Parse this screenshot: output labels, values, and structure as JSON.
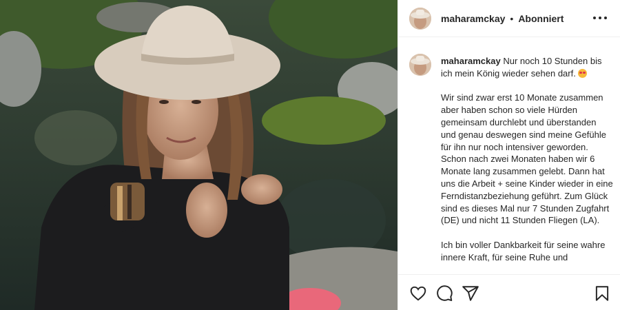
{
  "post": {
    "username": "maharamckay",
    "separator": "•",
    "follow_status": "Abonniert",
    "caption_lead": "Nur noch 10 Stunden bis ich mein König wieder sehen darf.",
    "caption_body": "Wir sind zwar erst 10 Monate zusammen aber haben schon so viele Hürden gemeinsam durchlebt und überstanden und genau deswegen sind meine Gefühle für ihn nur noch intensiver geworden. Schon nach zwei Monaten haben wir 6 Monate lang zusammen gelebt. Dann hat uns die Arbeit + seine Kinder wieder in eine Ferndistanzbeziehung geführt. Zum Glück sind es dieses Mal nur 7 Stunden Zugfahrt (DE) und nicht 11 Stunden Fliegen (LA).",
    "caption_tail": "Ich bin voller Dankbarkeit für seine wahre innere Kraft, für seine Ruhe und"
  },
  "icons": {
    "more": "more-options-icon",
    "like": "heart-icon",
    "comment": "comment-icon",
    "share": "paper-plane-icon",
    "save": "bookmark-icon",
    "emoji": "heart-eyes-emoji"
  },
  "colors": {
    "text": "#262626",
    "border": "#efefef",
    "background": "#ffffff"
  }
}
